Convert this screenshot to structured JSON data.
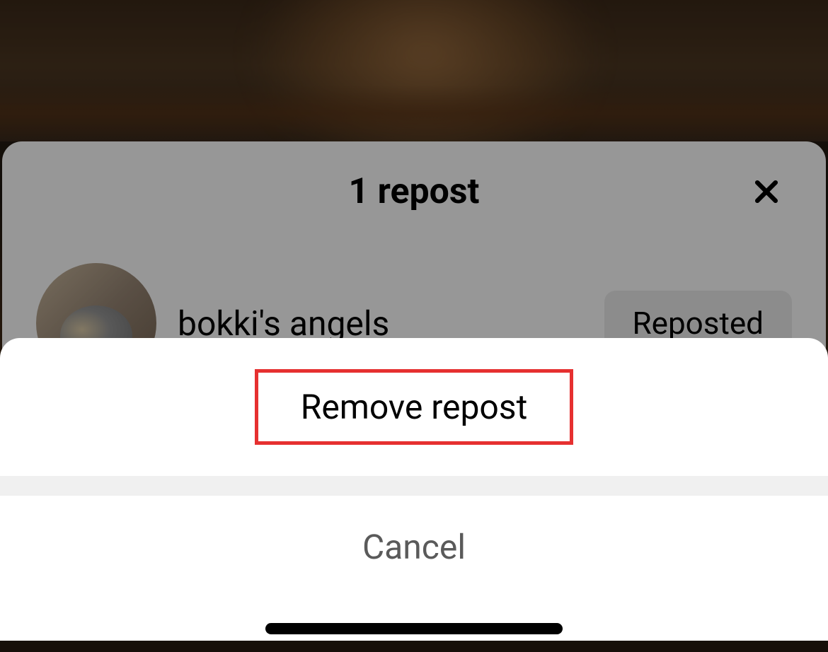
{
  "sheet": {
    "title": "1 repost",
    "user": {
      "name": "bokki's angels",
      "badge": "Reposted"
    }
  },
  "action_sheet": {
    "remove_repost": "Remove repost",
    "cancel": "Cancel"
  }
}
